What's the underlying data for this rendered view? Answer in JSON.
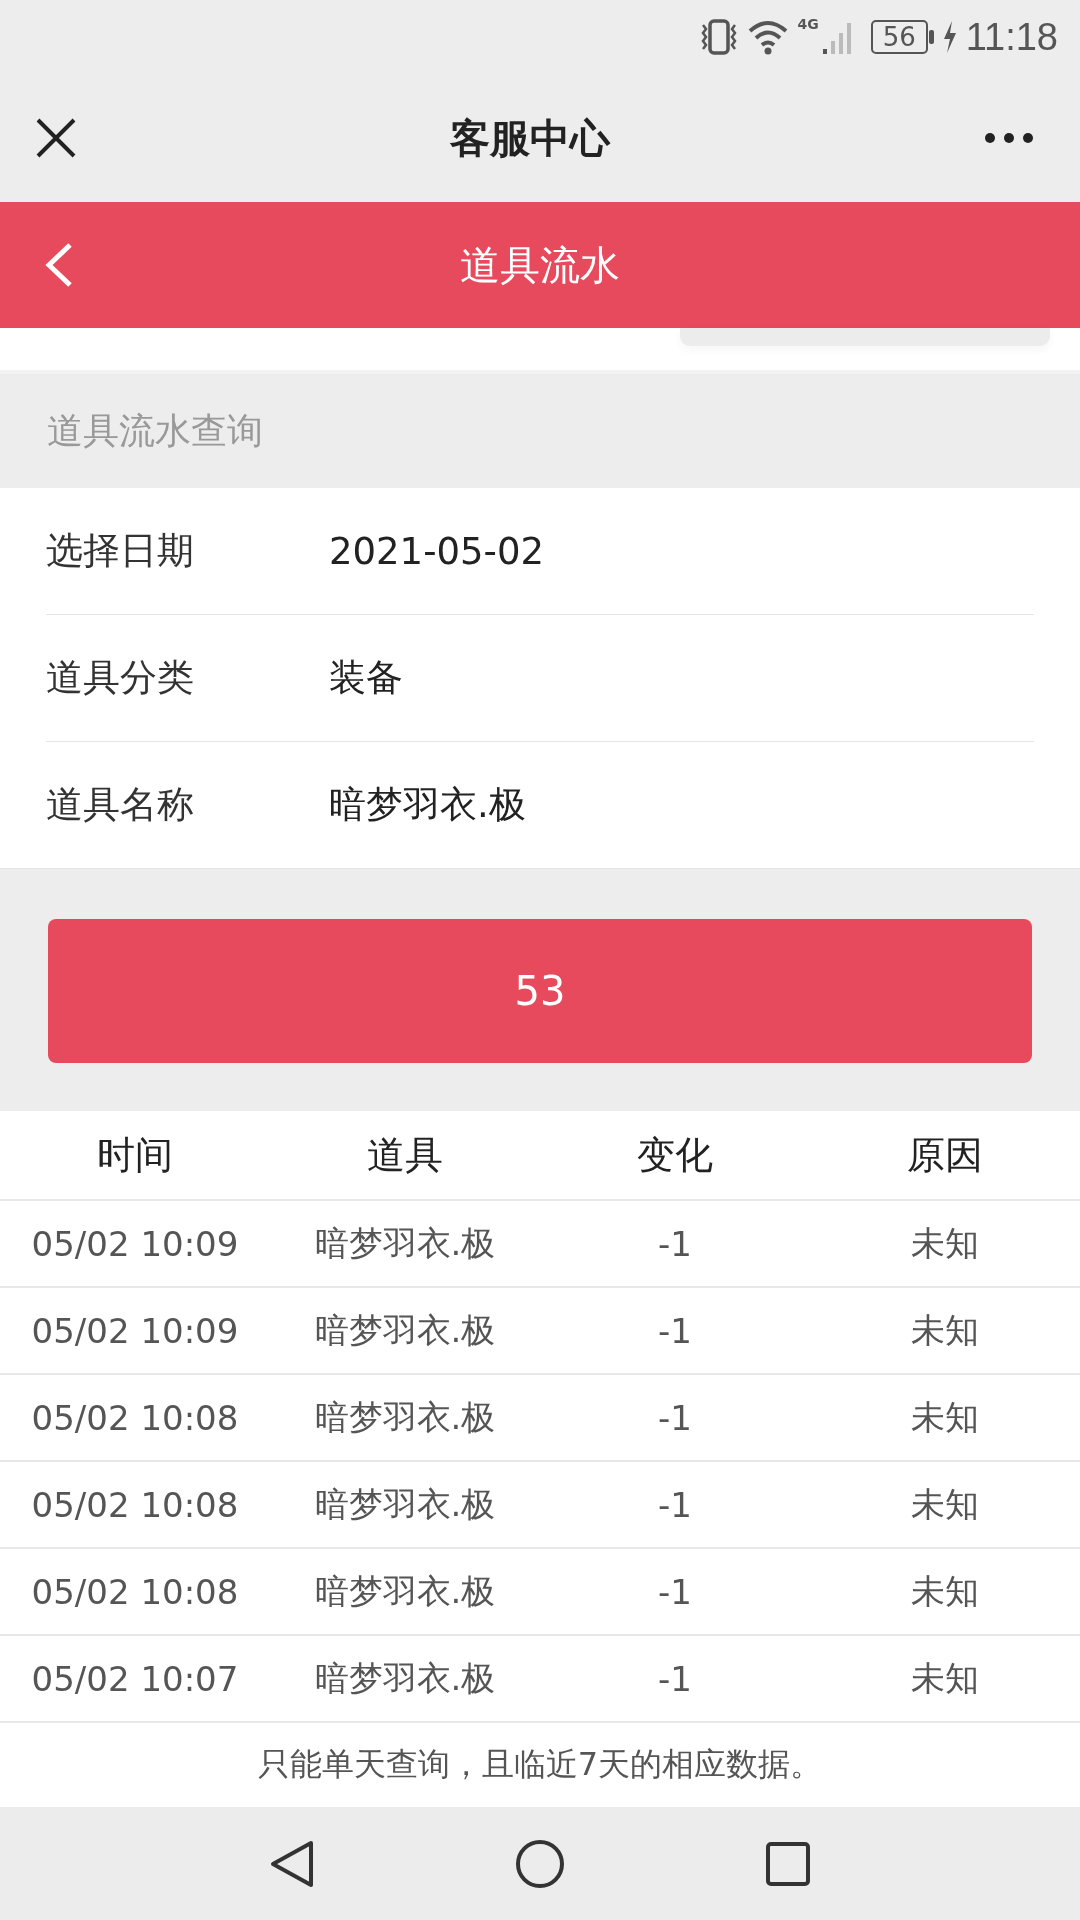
{
  "status_bar": {
    "network": "4G",
    "battery": "56",
    "time": "11:18"
  },
  "nav_bar": {
    "title": "客服中心"
  },
  "header": {
    "title": "道具流水"
  },
  "section": {
    "title": "道具流水查询"
  },
  "form": [
    {
      "label": "选择日期",
      "value": "2021-05-02"
    },
    {
      "label": "道具分类",
      "value": "装备"
    },
    {
      "label": "道具名称",
      "value": "暗梦羽衣.极"
    }
  ],
  "query_button": {
    "label": "53"
  },
  "table": {
    "columns": [
      "时间",
      "道具",
      "变化",
      "原因"
    ],
    "rows": [
      [
        "05/02 10:09",
        "暗梦羽衣.极",
        "-1",
        "未知"
      ],
      [
        "05/02 10:09",
        "暗梦羽衣.极",
        "-1",
        "未知"
      ],
      [
        "05/02 10:08",
        "暗梦羽衣.极",
        "-1",
        "未知"
      ],
      [
        "05/02 10:08",
        "暗梦羽衣.极",
        "-1",
        "未知"
      ],
      [
        "05/02 10:08",
        "暗梦羽衣.极",
        "-1",
        "未知"
      ],
      [
        "05/02 10:07",
        "暗梦羽衣.极",
        "-1",
        "未知"
      ]
    ]
  },
  "note": "只能单天查询，且临近7天的相应数据。"
}
